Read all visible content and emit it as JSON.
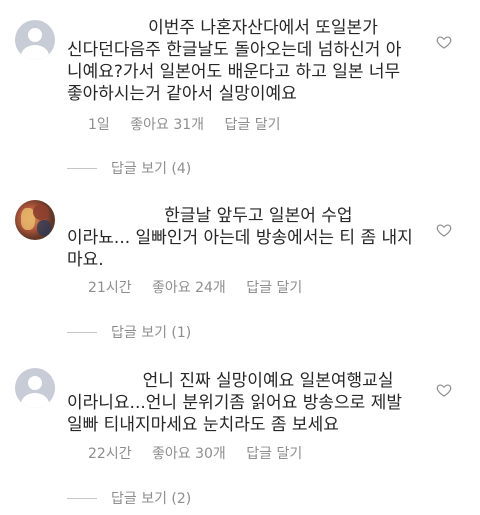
{
  "comments": [
    {
      "text": "               이번주 나혼자산다에서 또일본가\n신다던다음주 한글날도 돌아오는데 넘하신거 아\n니예요?가서 일본어도 배운다고 하고 일본 너무\n좋아하시는거 같아서 실망이예요",
      "time": "1일",
      "likes": "좋아요 31개",
      "reply": "답글 달기",
      "view_replies": "답글 보기 (4)",
      "avatar": "default-avatar"
    },
    {
      "text": "                  한글날 앞두고 일본어 수업\n이라뇨... 일빠인거 아는데 방송에서는 티 좀 내지\n마요.",
      "time": "21시간",
      "likes": "좋아요 24개",
      "reply": "답글 달기",
      "view_replies": "답글 보기 (1)",
      "avatar": "photo-avatar"
    },
    {
      "text": "              언니 진짜 실망이예요 일본여행교실\n이라니요...언니 분위기좀 읽어요 방송으로 제발\n일빠 티내지마세요 눈치라도 좀 보세요",
      "time": "22시간",
      "likes": "좋아요 30개",
      "reply": "답글 달기",
      "view_replies": "답글 보기 (2)",
      "avatar": "default-avatar"
    }
  ],
  "icons": {
    "like": "heart-outline-icon",
    "avatar_default": "default-user-icon"
  },
  "colors": {
    "text": "#262626",
    "meta": "#8e8e8e",
    "avatar_default_bg": "#c7ccd6",
    "divider": "#c7c7c7"
  }
}
